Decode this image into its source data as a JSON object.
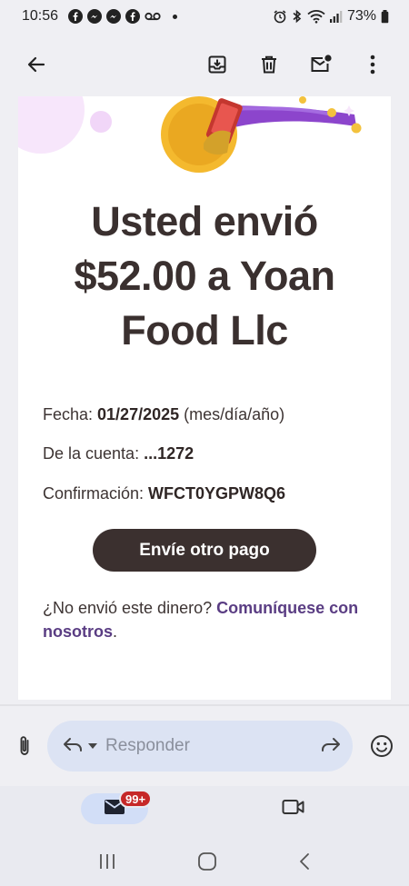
{
  "status_bar": {
    "time": "10:56",
    "battery": "73%",
    "left_icons": [
      "facebook-icon",
      "messenger-icon",
      "messenger-icon",
      "facebook-icon",
      "voicemail-icon"
    ],
    "right_icons": [
      "alarm-icon",
      "bluetooth-icon",
      "wifi-icon",
      "signal-icon",
      "battery-icon"
    ]
  },
  "app_bar": {
    "icons": [
      "back-arrow-icon",
      "archive-icon",
      "delete-icon",
      "mark-unread-icon",
      "more-vert-icon"
    ]
  },
  "email": {
    "headline_line1": "Usted envió",
    "headline_line2": "$52.00 a Yoan",
    "headline_line3": "Food Llc",
    "date_label": "Fecha: ",
    "date_value": "01/27/2025",
    "date_suffix": " (mes/día/año)",
    "account_label": "De la cuenta: ",
    "account_value": "...1272",
    "confirmation_label": "Confirmación: ",
    "confirmation_value": "WFCT0YGPW8Q6",
    "button_label": "Envíe otro pago",
    "footer_text": "¿No envió este dinero? ",
    "footer_link": "Comuníquese con nosotros",
    "footer_end": ".",
    "colors": {
      "heading": "#3a302f",
      "button": "#3b302f",
      "link": "#5a3d83"
    }
  },
  "reply_bar": {
    "placeholder": "Responder",
    "icons": [
      "attachment-icon",
      "reply-icon",
      "dropdown-icon",
      "forward-icon",
      "emoji-icon"
    ]
  },
  "bottom_nav": {
    "mail_badge": "99+",
    "icons": [
      "mail-icon",
      "video-meet-icon"
    ]
  },
  "system_nav": {
    "icons": [
      "recent-apps-icon",
      "home-icon",
      "back-icon"
    ]
  }
}
